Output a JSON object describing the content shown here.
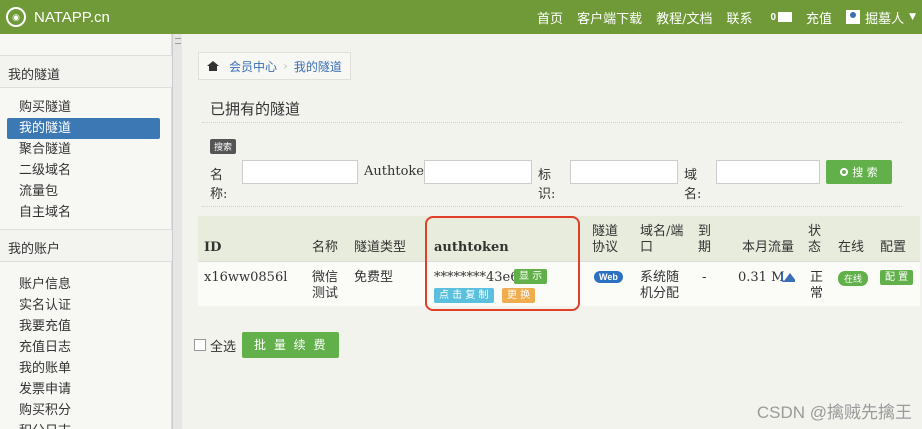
{
  "topbar": {
    "brand": "NATAPP.cn",
    "nav": [
      "首页",
      "客户端下载",
      "教程/文档",
      "联系"
    ],
    "msg_count": "0",
    "recharge": "充值",
    "username": "掘墓人"
  },
  "sidebar": {
    "section1": "我的隧道",
    "section1_items": [
      "购买隧道",
      "我的隧道",
      "聚合隧道",
      "二级域名",
      "流量包",
      "自主域名"
    ],
    "section2": "我的账户",
    "section2_items": [
      "账户信息",
      "实名认证",
      "我要充值",
      "充值日志",
      "我的账单",
      "发票申请",
      "购买积分",
      "积分日志"
    ]
  },
  "breadcrumb": [
    "会员中心",
    "我的隧道"
  ],
  "page_title": "已拥有的隧道",
  "search": {
    "tag": "搜索",
    "name_label": "名称:",
    "authtoken_label": "Authtoken:",
    "ident_label": "标识:",
    "domain_label": "域名:",
    "button": "搜 索"
  },
  "table": {
    "headers": {
      "id": "ID",
      "name": "名称",
      "type": "隧道类型",
      "authtoken": "authtoken",
      "protocol": [
        "隧道",
        "协议"
      ],
      "domain": [
        "域名/端",
        "口"
      ],
      "expire": [
        "到",
        "期"
      ],
      "traffic": "本月流量",
      "status": [
        "状",
        "态"
      ],
      "online": "在线",
      "config": "配置"
    },
    "row": {
      "id": "x16ww0856l",
      "name": [
        "微信",
        "测试"
      ],
      "type": "免费型",
      "authtoken": "********43e6",
      "show": "显 示",
      "copy": "点 击 复 制",
      "change": "更 换",
      "protocol": "Web",
      "domain": [
        "系统随",
        "机分配"
      ],
      "expire": "-",
      "traffic": "0.31 M",
      "status": [
        "正",
        "常"
      ],
      "online": "在线",
      "config": "配 置"
    }
  },
  "bottom": {
    "select_all": "全选",
    "batch_renew": "批 量 续 费"
  },
  "watermark": "CSDN @擒贼先擒王"
}
